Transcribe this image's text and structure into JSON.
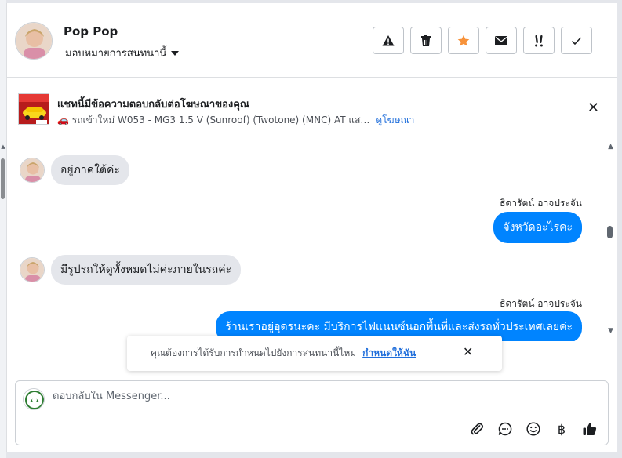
{
  "header": {
    "contact_name": "Pop Pop",
    "assign_label": "มอบหมายการสนทนานี้"
  },
  "actions": [
    {
      "icon": "alert-triangle-icon",
      "glyph": "⚠"
    },
    {
      "icon": "trash-icon",
      "glyph": ""
    },
    {
      "icon": "star-icon",
      "glyph": "★"
    },
    {
      "icon": "envelope-icon",
      "glyph": "✉"
    },
    {
      "icon": "follow-up-icon",
      "glyph": "!!"
    },
    {
      "icon": "check-icon",
      "glyph": "✓"
    }
  ],
  "ad": {
    "title": "แชทนี้มีข้อความตอบกลับต่อโฆษณาของคุณ",
    "subtitle": "🚗 รถเข้าใหม่ W053 - MG3 1.5 V (Sunroof) (Twotone) (MNC) AT แส…",
    "link": "ดูโฆษณา",
    "close": "✕"
  },
  "messages": [
    {
      "direction": "in",
      "text": "อยู่ภาคใต้ค่ะ"
    },
    {
      "direction": "out",
      "sender": "ธิดารัตน์ อาจประจัน",
      "text": "จังหวัดอะไรคะ"
    },
    {
      "direction": "in",
      "text": "มีรูปรถให้ดูทั้งหมดไม่ค่ะภายในรถค่ะ"
    },
    {
      "direction": "out",
      "sender": "ธิดารัตน์ อาจประจัน",
      "text": "ร้านเราอยู่อุดรนะคะ มีบริการไฟแนนซ์นอกพื้นที่และส่งรถทั่วประเทศเลยค่ะ"
    }
  ],
  "toast": {
    "text": "คุณต้องการได้รับการกำหนดไปยังการสนทนานี้ไหม",
    "link": "กำหนดให้ฉัน",
    "close": "✕"
  },
  "composer": {
    "placeholder": "ตอบกลับใน Messenger..."
  },
  "tools": [
    {
      "icon": "paperclip-icon"
    },
    {
      "icon": "saved-reply-icon"
    },
    {
      "icon": "emoji-icon"
    },
    {
      "icon": "baht-icon",
      "glyph": "฿"
    },
    {
      "icon": "thumbs-up-icon"
    }
  ],
  "colors": {
    "accent": "#0084ff",
    "link": "#216fdb",
    "star": "#f7923a"
  }
}
